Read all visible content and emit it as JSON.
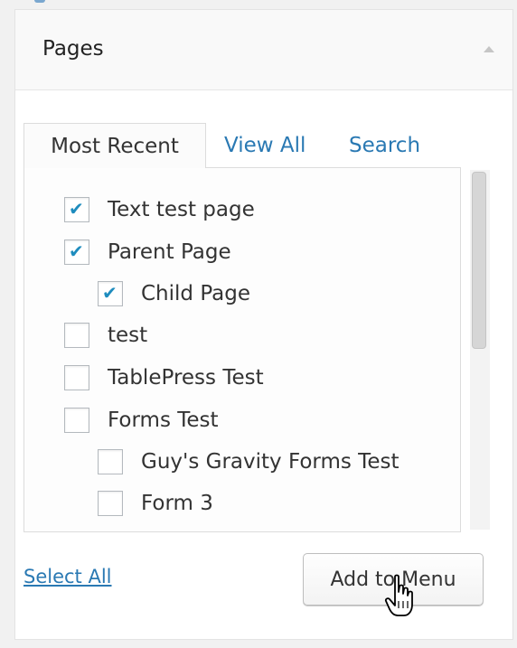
{
  "panel": {
    "title": "Pages"
  },
  "tabs": [
    {
      "label": "Most Recent",
      "active": true
    },
    {
      "label": "View All",
      "active": false
    },
    {
      "label": "Search",
      "active": false
    }
  ],
  "items": [
    {
      "label": "Text test page",
      "checked": true,
      "indent": 0
    },
    {
      "label": "Parent Page",
      "checked": true,
      "indent": 0
    },
    {
      "label": "Child Page",
      "checked": true,
      "indent": 1
    },
    {
      "label": "test",
      "checked": false,
      "indent": 0
    },
    {
      "label": "TablePress Test",
      "checked": false,
      "indent": 0
    },
    {
      "label": "Forms Test",
      "checked": false,
      "indent": 0
    },
    {
      "label": "Guy's Gravity Forms Test",
      "checked": false,
      "indent": 1
    },
    {
      "label": "Form 3",
      "checked": false,
      "indent": 1
    }
  ],
  "footer": {
    "select_all": "Select All",
    "add_button": "Add to Menu"
  },
  "colors": {
    "link": "#2a79b3",
    "check": "#1e8cbe"
  }
}
